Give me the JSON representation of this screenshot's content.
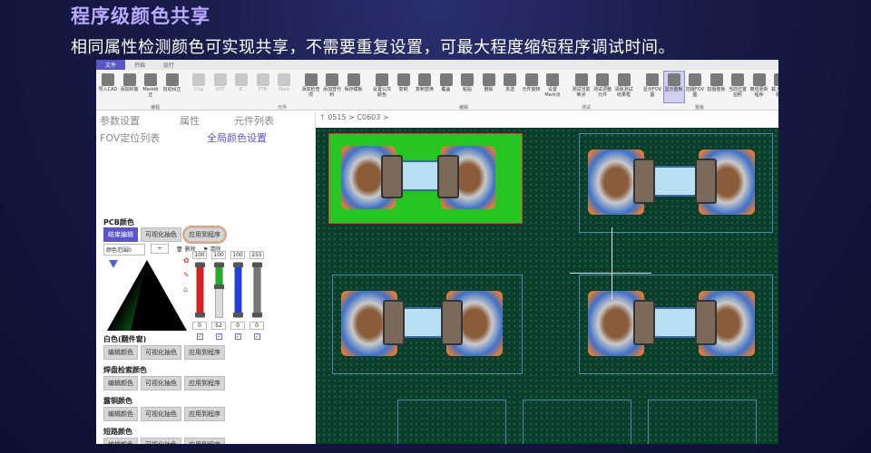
{
  "slide": {
    "title": "程序级颜色共享",
    "subtitle": "相同属性检测颜色可实现共享，不需要重复设置，可最大程度缩短程序调试时间。"
  },
  "ribbon": {
    "tabs": [
      "文件",
      "开始",
      "运行"
    ],
    "active_tab": "文件",
    "buttons": [
      {
        "label": "导入CAD",
        "icon": "import-cad-icon"
      },
      {
        "label": "添加封装",
        "icon": "add-package-icon"
      },
      {
        "label": "Mark纠正",
        "icon": "mark-correct-icon"
      },
      {
        "label": "自动纠正",
        "icon": "auto-correct-icon"
      },
      {
        "label": "Chip",
        "icon": "chip-icon"
      },
      {
        "label": "SOT",
        "icon": "sot-icon"
      },
      {
        "label": "IC",
        "icon": "ic-icon"
      },
      {
        "label": "PTH",
        "icon": "pth-icon"
      },
      {
        "label": "Mark",
        "icon": "mark-icon"
      },
      {
        "label": "添加检查项",
        "icon": "add-check-icon"
      },
      {
        "label": "添加替代料",
        "icon": "add-substitute-icon"
      },
      {
        "label": "保存模板",
        "icon": "save-template-icon"
      },
      {
        "label": "设置公共颜色",
        "icon": "set-common-color-icon"
      },
      {
        "label": "复制",
        "icon": "copy-icon"
      },
      {
        "label": "复制替换",
        "icon": "copy-replace-icon"
      },
      {
        "label": "覆盖",
        "icon": "overwrite-icon"
      },
      {
        "label": "粘贴",
        "icon": "paste-icon"
      },
      {
        "label": "删除",
        "icon": "delete-icon"
      },
      {
        "label": "多选",
        "icon": "multi-select-icon"
      },
      {
        "label": "元件旋转",
        "icon": "rotate-component-icon"
      },
      {
        "label": "设置Mark点",
        "icon": "set-mark-icon"
      },
      {
        "label": "测试当前焦点",
        "icon": "test-focus-icon"
      },
      {
        "label": "测试调整元件",
        "icon": "test-adjust-icon"
      },
      {
        "label": "清除测试结果框",
        "icon": "clear-results-icon"
      },
      {
        "label": "显示FOV图",
        "icon": "show-fov-icon"
      },
      {
        "label": "显示整板",
        "icon": "show-board-icon"
      },
      {
        "label": "拍摄FOV图",
        "icon": "capture-fov-icon"
      },
      {
        "label": "拍摄整板",
        "icon": "capture-board-icon"
      },
      {
        "label": "当前位置拍照",
        "icon": "capture-current-icon"
      },
      {
        "label": "离线更新程序",
        "icon": "offline-update-icon"
      },
      {
        "label": "载入压缩程序",
        "icon": "load-compressed-icon"
      }
    ],
    "group_labels": [
      "编程",
      "元件",
      "编辑",
      "测试",
      "整板"
    ]
  },
  "panel": {
    "tabs": {
      "params": "参数设置",
      "attributes": "属性",
      "components": "元件列表",
      "fov": "FOV定位列表",
      "global_color": "全局颜色设置"
    },
    "pcb_section": "PCB颜色",
    "pcb_buttons": {
      "finish": "结束编辑",
      "visualize": "可视化抽色",
      "apply": "应用到程序"
    },
    "color_range_label": "颜色范围0",
    "plus": "+",
    "delete": "删除",
    "clear": "清除",
    "slider_top": [
      "100",
      "100",
      "100",
      "255"
    ],
    "slider_bottom": [
      "0",
      "52",
      "0",
      "0"
    ],
    "slider_levels": [
      {
        "color": "#e02020",
        "low": 0,
        "high": 100
      },
      {
        "color": "#20b020",
        "low": 52,
        "high": 100
      },
      {
        "color": "#1f3fe0",
        "low": 0,
        "high": 100
      },
      {
        "color": "#777777",
        "low": 0,
        "high": 255
      }
    ],
    "sections": [
      {
        "title": "白色(翻件窗)",
        "edit": "编辑颜色",
        "visualize": "可视化抽色",
        "apply": "应用到程序"
      },
      {
        "title": "焊盘检索颜色",
        "edit": "编辑颜色",
        "visualize": "可视化抽色",
        "apply": "应用到程序"
      },
      {
        "title": "露铜颜色",
        "edit": "编辑颜色",
        "visualize": "可视化抽色",
        "apply": "应用到程序"
      },
      {
        "title": "短路颜色",
        "edit": "编辑颜色",
        "visualize": "可视化抽色",
        "apply": "应用到程序"
      }
    ]
  },
  "image": {
    "breadcrumb": [
      "0515",
      "C0603"
    ]
  }
}
